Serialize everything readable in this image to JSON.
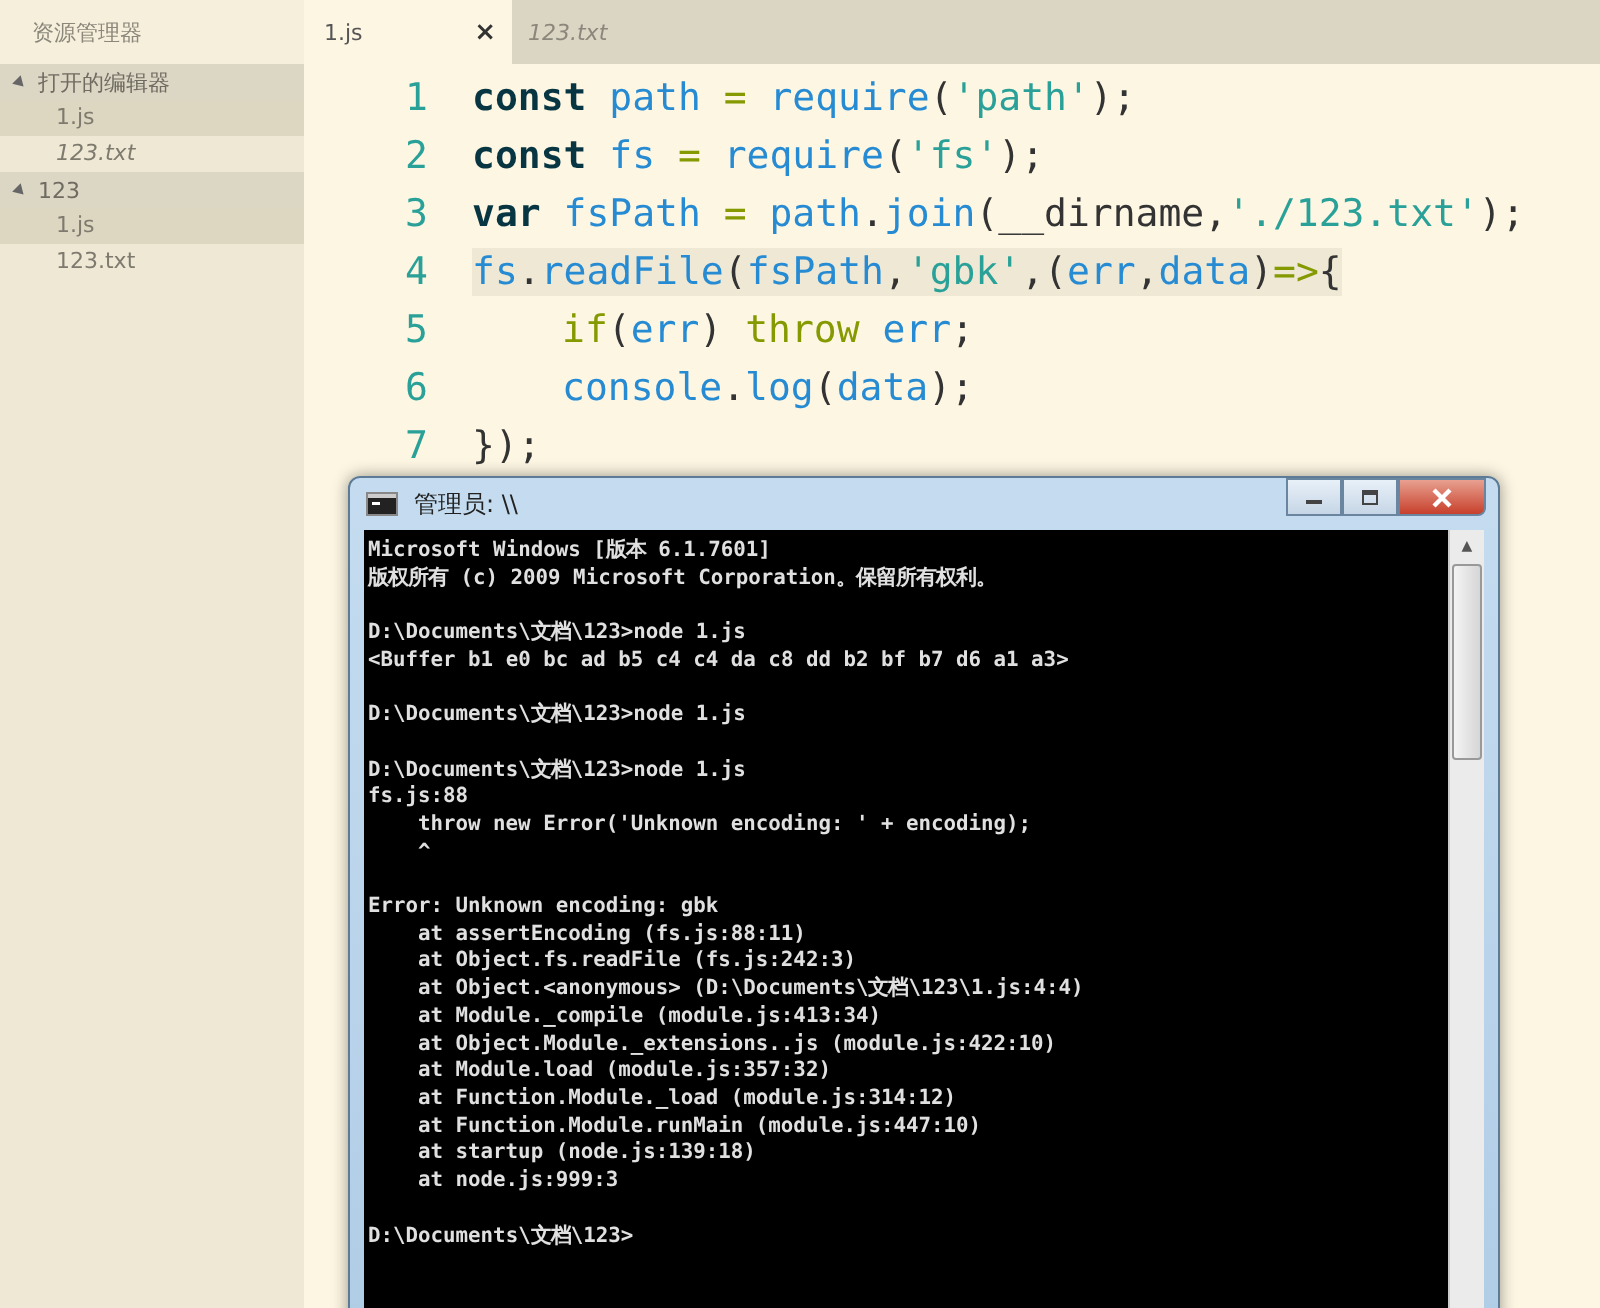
{
  "sidebar": {
    "title": "资源管理器",
    "groups": [
      {
        "label": "打开的编辑器",
        "expanded": true,
        "items": [
          {
            "label": "1.js",
            "selected": true,
            "preview": false
          },
          {
            "label": "123.txt",
            "selected": false,
            "preview": true
          }
        ]
      },
      {
        "label": "123",
        "expanded": true,
        "items": [
          {
            "label": "1.js",
            "selected": true,
            "preview": false
          },
          {
            "label": "123.txt",
            "selected": false,
            "preview": false
          }
        ]
      }
    ]
  },
  "tabs": [
    {
      "label": "1.js",
      "selected": true,
      "preview": false,
      "close": "×"
    },
    {
      "label": "123.txt",
      "selected": false,
      "preview": true
    }
  ],
  "editor": {
    "lines": [
      {
        "number": "1",
        "current": false,
        "tokens": [
          {
            "text": "const ",
            "kind": "keyword"
          },
          {
            "text": "path ",
            "kind": "ident"
          },
          {
            "text": "= ",
            "kind": "op"
          },
          {
            "text": "require",
            "kind": "ident"
          },
          {
            "text": "(",
            "kind": "punct"
          },
          {
            "text": "'path'",
            "kind": "string"
          },
          {
            "text": ");",
            "kind": "punct"
          }
        ]
      },
      {
        "number": "2",
        "current": false,
        "tokens": [
          {
            "text": "const ",
            "kind": "keyword"
          },
          {
            "text": "fs ",
            "kind": "ident"
          },
          {
            "text": "= ",
            "kind": "op"
          },
          {
            "text": "require",
            "kind": "ident"
          },
          {
            "text": "(",
            "kind": "punct"
          },
          {
            "text": "'fs'",
            "kind": "string"
          },
          {
            "text": ");",
            "kind": "punct"
          }
        ]
      },
      {
        "number": "3",
        "current": false,
        "tokens": [
          {
            "text": "var ",
            "kind": "keyword"
          },
          {
            "text": "fsPath ",
            "kind": "ident"
          },
          {
            "text": "= ",
            "kind": "op"
          },
          {
            "text": "path",
            "kind": "ident"
          },
          {
            "text": ".",
            "kind": "punct"
          },
          {
            "text": "join",
            "kind": "ident"
          },
          {
            "text": "(__dirname,",
            "kind": "punct"
          },
          {
            "text": "'./123.txt'",
            "kind": "string"
          },
          {
            "text": ");",
            "kind": "punct"
          }
        ]
      },
      {
        "number": "4",
        "current": true,
        "tokens": [
          {
            "text": "fs",
            "kind": "ident"
          },
          {
            "text": ".",
            "kind": "punct"
          },
          {
            "text": "readFile",
            "kind": "ident"
          },
          {
            "text": "(",
            "kind": "punct"
          },
          {
            "text": "fsPath",
            "kind": "ident"
          },
          {
            "text": ",",
            "kind": "punct"
          },
          {
            "text": "'gbk'",
            "kind": "string"
          },
          {
            "text": ",(",
            "kind": "punct"
          },
          {
            "text": "err",
            "kind": "ident"
          },
          {
            "text": ",",
            "kind": "punct"
          },
          {
            "text": "data",
            "kind": "ident"
          },
          {
            "text": ")",
            "kind": "punct"
          },
          {
            "text": "=>",
            "kind": "op"
          },
          {
            "text": "{",
            "kind": "punct"
          }
        ],
        "children": [
          {
            "number": "5",
            "current": false,
            "tokens": [
              {
                "text": "if",
                "kind": "op"
              },
              {
                "text": "(",
                "kind": "punct"
              },
              {
                "text": "err",
                "kind": "ident"
              },
              {
                "text": ") ",
                "kind": "punct"
              },
              {
                "text": "throw ",
                "kind": "op"
              },
              {
                "text": "err",
                "kind": "ident"
              },
              {
                "text": ";",
                "kind": "punct"
              }
            ]
          },
          {
            "number": "6",
            "current": false,
            "tokens": [
              {
                "text": "console",
                "kind": "ident"
              },
              {
                "text": ".",
                "kind": "punct"
              },
              {
                "text": "log",
                "kind": "ident"
              },
              {
                "text": "(",
                "kind": "punct"
              },
              {
                "text": "data",
                "kind": "ident"
              },
              {
                "text": ");",
                "kind": "punct"
              }
            ]
          }
        ]
      },
      {
        "number": "7",
        "current": false,
        "tokens": [
          {
            "text": "});",
            "kind": "punct"
          }
        ]
      }
    ]
  },
  "console": {
    "title": "管理员: \\\\",
    "scroll_up": "▲",
    "blocks": [
      {
        "lines": [
          {
            "text": "Microsoft Windows [版本 6.1.7601]"
          },
          {
            "text": "版权所有 (c) 2009 Microsoft Corporation。保留所有权利。"
          }
        ]
      },
      {
        "lines": [
          {
            "text": "D:\\Documents\\文档\\123>node 1.js"
          },
          {
            "text": "<Buffer b1 e0 bc ad b5 c4 c4 da c8 dd b2 bf b7 d6 a1 a3>"
          }
        ]
      },
      {
        "lines": [
          {
            "text": "D:\\Documents\\文档\\123>node 1.js"
          }
        ]
      },
      {
        "lines": [
          {
            "text": "D:\\Documents\\文档\\123>node 1.js"
          },
          {
            "text": "fs.js:88",
            "children": [
              {
                "text": "throw new Error('Unknown encoding: ' + encoding);"
              },
              {
                "text": "^"
              }
            ]
          }
        ]
      },
      {
        "lines": [
          {
            "text": "Error: Unknown encoding: gbk",
            "children": [
              {
                "text": "at assertEncoding (fs.js:88:11)"
              },
              {
                "text": "at Object.fs.readFile (fs.js:242:3)"
              },
              {
                "text": "at Object.<anonymous> (D:\\Documents\\文档\\123\\1.js:4:4)"
              },
              {
                "text": "at Module._compile (module.js:413:34)"
              },
              {
                "text": "at Object.Module._extensions..js (module.js:422:10)"
              },
              {
                "text": "at Module.load (module.js:357:32)"
              },
              {
                "text": "at Function.Module._load (module.js:314:12)"
              },
              {
                "text": "at Function.Module.runMain (module.js:447:10)"
              },
              {
                "text": "at startup (node.js:139:18)"
              },
              {
                "text": "at node.js:999:3"
              }
            ]
          }
        ]
      },
      {
        "lines": [
          {
            "text": "D:\\Documents\\文档\\123>"
          }
        ]
      }
    ]
  }
}
